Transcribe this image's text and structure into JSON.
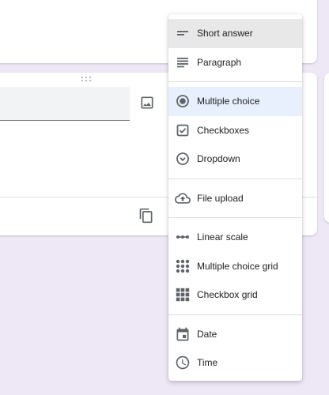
{
  "question_type_menu": {
    "items": [
      {
        "label": "Short answer",
        "icon": "short-answer-icon"
      },
      {
        "label": "Paragraph",
        "icon": "paragraph-icon"
      },
      {
        "label": "Multiple choice",
        "icon": "radio-button-icon",
        "selected": true
      },
      {
        "label": "Checkboxes",
        "icon": "checkbox-icon"
      },
      {
        "label": "Dropdown",
        "icon": "dropdown-icon"
      },
      {
        "label": "File upload",
        "icon": "cloud-upload-icon"
      },
      {
        "label": "Linear scale",
        "icon": "linear-scale-icon"
      },
      {
        "label": "Multiple choice grid",
        "icon": "radio-grid-icon"
      },
      {
        "label": "Checkbox grid",
        "icon": "checkbox-grid-icon"
      },
      {
        "label": "Date",
        "icon": "calendar-icon"
      },
      {
        "label": "Time",
        "icon": "clock-icon"
      }
    ]
  },
  "colors": {
    "page_background": "#ede7f6",
    "selected_item_background": "#e8f0fe",
    "hover_item_background": "#e8e8e8",
    "icon": "#5f6368"
  }
}
